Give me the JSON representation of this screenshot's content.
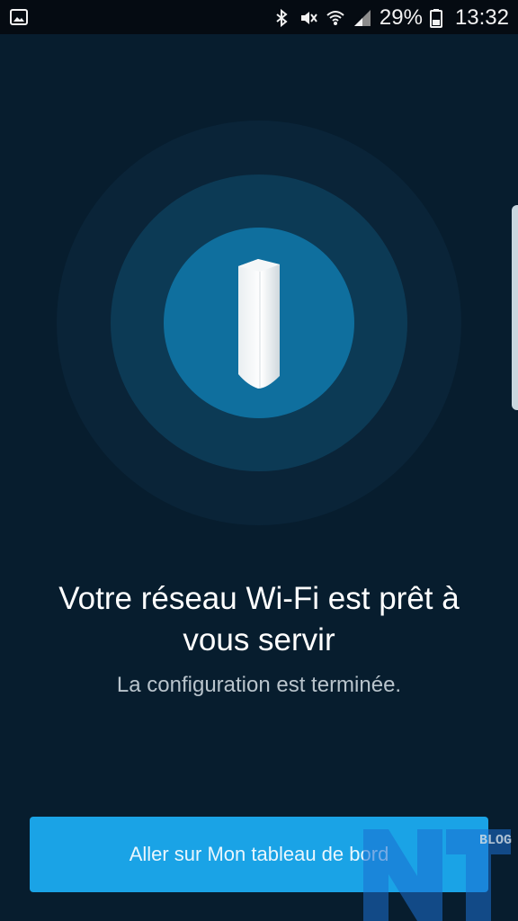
{
  "status_bar": {
    "gallery_icon": "image-icon",
    "bluetooth_icon": "bluetooth-icon",
    "mute_icon": "mute-icon",
    "wifi_icon": "wifi-icon",
    "signal_icon": "signal-icon",
    "battery_percent": "29%",
    "battery_icon": "battery-icon",
    "time": "13:32"
  },
  "hero": {
    "device_icon": "mesh-node-icon"
  },
  "content": {
    "headline": "Votre réseau Wi-Fi est prêt à vous servir",
    "subtitle": "La configuration est terminée."
  },
  "actions": {
    "primary_label": "Aller sur Mon tableau de bord"
  },
  "watermark": {
    "text": "BLOG"
  },
  "colors": {
    "background": "#071d2e",
    "accent": "#1aa3e6",
    "ring_inner": "#0f6f9e"
  }
}
